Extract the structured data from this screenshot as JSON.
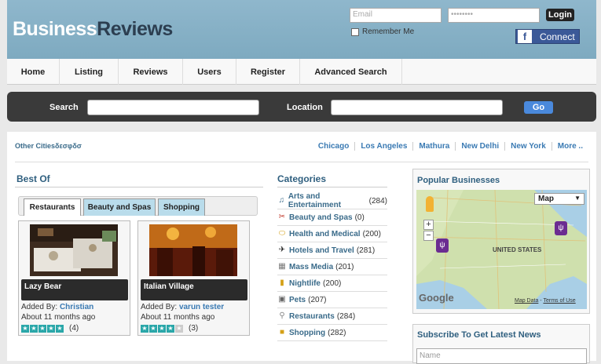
{
  "brand": {
    "part1": "Business",
    "part2": "Reviews"
  },
  "login": {
    "email_placeholder": "Email",
    "password_placeholder": "••••••••",
    "login_label": "Login",
    "remember_label": "Remember Me",
    "facebook_label": "Connect"
  },
  "nav": {
    "items": [
      "Home",
      "Listing",
      "Reviews",
      "Users",
      "Register",
      "Advanced Search"
    ]
  },
  "search": {
    "search_label": "Search",
    "location_label": "Location",
    "go_label": "Go"
  },
  "cities": {
    "other_label": "Other Citiesδεσφδσ",
    "links": [
      "Chicago",
      "Los Angeles",
      "Mathura",
      "New Delhi",
      "New York",
      "More .."
    ]
  },
  "best_of": {
    "title": "Best Of",
    "tabs": [
      "Restaurants",
      "Beauty and Spas",
      "Shopping"
    ],
    "active_tab": "Restaurants",
    "cards": [
      {
        "name": "Lazy Bear",
        "added_by_label": "Added By:",
        "added_by": "Christian",
        "ago": "About 11 months ago",
        "rating": 5,
        "count": "(4)"
      },
      {
        "name": "Italian Village",
        "added_by_label": "Added By:",
        "added_by": "varun tester",
        "ago": "About 11 months ago",
        "rating": 4,
        "count": "(3)"
      }
    ]
  },
  "categories": {
    "title": "Categories",
    "items": [
      {
        "label": "Arts and Entertainment",
        "count": "(284)",
        "icon": "music-note-icon"
      },
      {
        "label": "Beauty and Spas",
        "count": "(0)",
        "icon": "scissors-icon"
      },
      {
        "label": "Health and Medical",
        "count": "(200)",
        "icon": "pill-icon"
      },
      {
        "label": "Hotels and Travel",
        "count": "(281)",
        "icon": "airplane-icon"
      },
      {
        "label": "Mass Media",
        "count": "(201)",
        "icon": "media-icon"
      },
      {
        "label": "Nightlife",
        "count": "(200)",
        "icon": "drink-icon"
      },
      {
        "label": "Pets",
        "count": "(207)",
        "icon": "pets-icon"
      },
      {
        "label": "Restaurants",
        "count": "(284)",
        "icon": "fork-icon"
      },
      {
        "label": "Shopping",
        "count": "(282)",
        "icon": "shopping-bag-icon"
      }
    ]
  },
  "popular": {
    "title": "Popular Businesses",
    "map_type": "Map",
    "map_label": "UNITED STATES",
    "google": "Google",
    "map_data": "Map Data",
    "terms": "Terms of Use",
    "zoom_in": "+",
    "zoom_out": "−"
  },
  "subscribe": {
    "title": "Subscribe To Get Latest News",
    "name_placeholder": "Name"
  },
  "colors": {
    "header": "#8fb7cc",
    "dark_bar": "#3a3a3a",
    "accent_link": "#3a7ab3",
    "go_button": "#4a89dc",
    "facebook": "#3b5998",
    "star": "#2aa7a9"
  }
}
